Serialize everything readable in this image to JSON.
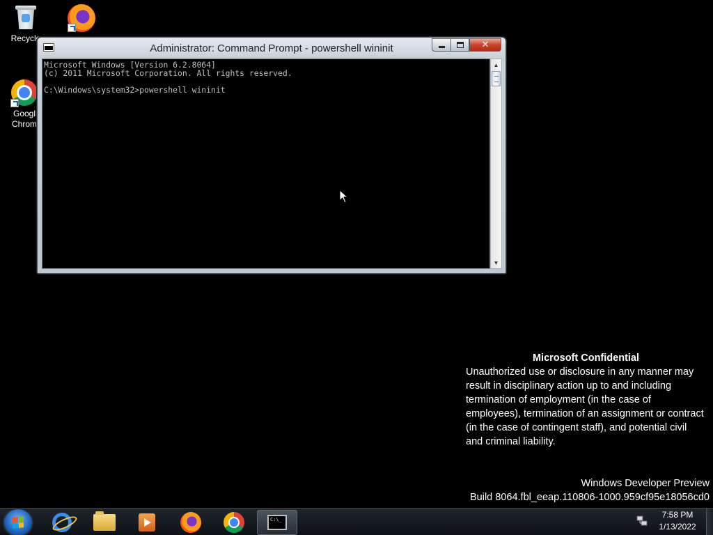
{
  "desktop": {
    "icons": [
      {
        "label": "Recycle"
      },
      {
        "label": ""
      },
      {
        "label": "Googl\nChrom"
      }
    ]
  },
  "window": {
    "title": "Administrator: Command Prompt - powershell  wininit",
    "console_text": "Microsoft Windows [Version 6.2.8064]\n(c) 2011 Microsoft Corporation. All rights reserved.\n\nC:\\Windows\\system32>powershell wininit",
    "caption": {
      "minimize": "minimize",
      "maximize": "maximize",
      "close": "✕"
    }
  },
  "watermark": {
    "heading": "Microsoft Confidential",
    "body": "Unauthorized use or disclosure in any manner may result in disciplinary action up to and including termination of employment (in the case of employees), termination of an assignment or contract (in the case of contingent staff), and potential civil and criminal liability.",
    "edition": "Windows Developer Preview",
    "build": "Build 8064.fbl_eeap.110806-1000.959cf95e18056cd0"
  },
  "taskbar": {
    "apps": [
      {
        "name": "internet-explorer",
        "icon": "ie-icon"
      },
      {
        "name": "file-explorer",
        "icon": "folder-icon"
      },
      {
        "name": "media-player",
        "icon": "media-player-icon"
      },
      {
        "name": "firefox",
        "icon": "firefox-icon"
      },
      {
        "name": "chrome",
        "icon": "chrome-icon"
      },
      {
        "name": "command-prompt",
        "icon": "cmd-icon",
        "active": true
      }
    ],
    "cmd_glyph": "C:\\_",
    "clock": {
      "time": "7:58 PM",
      "date": "1/13/2022"
    }
  },
  "colors": {
    "desktop_bg": "#000000",
    "console_bg": "#000000",
    "console_text": "#c0c0c0",
    "close_button": "#c7432a"
  }
}
